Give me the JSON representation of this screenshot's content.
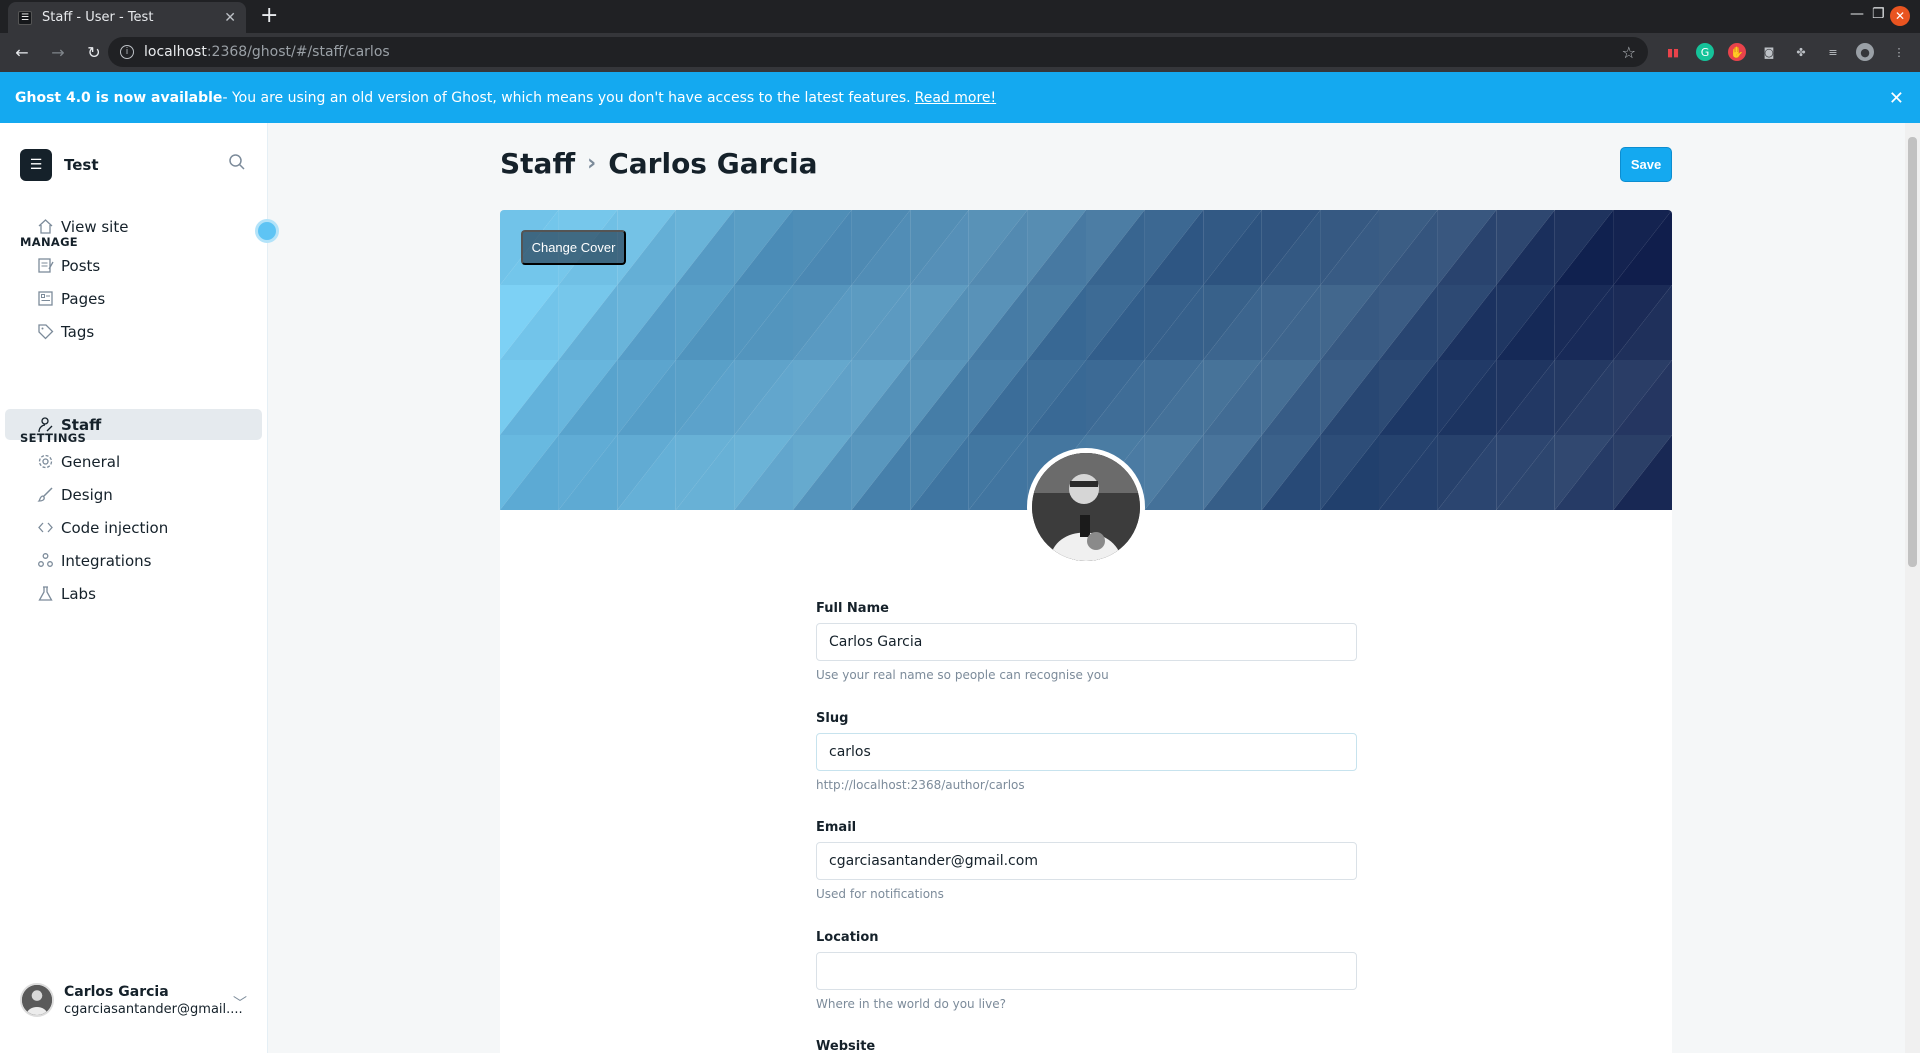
{
  "browser": {
    "tab_title": "Staff - User - Test",
    "url_host": "localhost",
    "url_path": ":2368/ghost/#/staff/carlos"
  },
  "banner": {
    "strong": "Ghost 4.0 is now available",
    "text": " - You are using an old version of Ghost, which means you don't have access to the latest features.",
    "link": "Read more!"
  },
  "sidebar": {
    "site_name": "Test",
    "view_site": "View site",
    "manage_label": "MANAGE",
    "manage_items": [
      {
        "label": "Posts"
      },
      {
        "label": "Pages"
      },
      {
        "label": "Tags"
      },
      {
        "label": "Staff"
      }
    ],
    "settings_label": "SETTINGS",
    "settings_items": [
      {
        "label": "General"
      },
      {
        "label": "Design"
      },
      {
        "label": "Code injection"
      },
      {
        "label": "Integrations"
      },
      {
        "label": "Labs"
      }
    ],
    "user": {
      "name": "Carlos Garcia",
      "email": "cgarciasantander@gmail...."
    }
  },
  "header": {
    "breadcrumb_parent": "Staff",
    "title": "Carlos Garcia",
    "save_label": "Save"
  },
  "cover": {
    "change_cover_label": "Change Cover"
  },
  "form": {
    "full_name": {
      "label": "Full Name",
      "value": "Carlos Garcia",
      "help": "Use your real name so people can recognise you"
    },
    "slug": {
      "label": "Slug",
      "value": "carlos",
      "help": "http://localhost:2368/author/carlos"
    },
    "email": {
      "label": "Email",
      "value": "cgarciasantander@gmail.com",
      "help": "Used for notifications"
    },
    "location": {
      "label": "Location",
      "value": "",
      "help": "Where in the world do you live?"
    },
    "website": {
      "label": "Website"
    }
  },
  "colors": {
    "accent": "#14a9f0",
    "sidebar_active": "#e5eaee",
    "text": "#15212a"
  }
}
